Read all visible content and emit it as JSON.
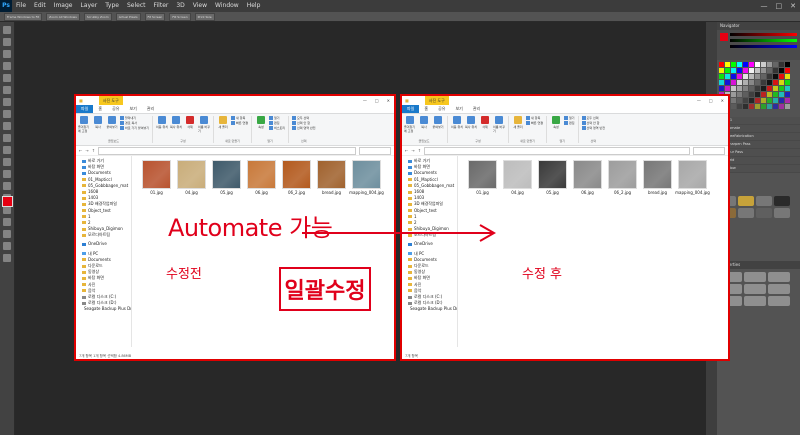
{
  "photoshop": {
    "logo": "Ps",
    "menu": [
      "File",
      "Edit",
      "Image",
      "Layer",
      "Type",
      "Select",
      "Filter",
      "3D",
      "View",
      "Window",
      "Help"
    ],
    "window_controls": [
      "—",
      "□",
      "✕"
    ],
    "options_bar": [
      "Frame Windows to Fit",
      "Zoom All Windows",
      "Scrubby Zoom",
      "Actual Pixels",
      "Fit Screen",
      "Fill Screen",
      "Print Size"
    ],
    "panels": {
      "navigator": "Navigator",
      "actions": [
        "Set 1",
        "Automate",
        "FreeFabrication",
        "Sharpen Pass",
        "Blur Pass",
        "Grid",
        "Glow"
      ],
      "properties": "Properties"
    }
  },
  "before_window": {
    "title_tab": "사진 도구",
    "tabs": [
      "파일",
      "홈",
      "공유",
      "보기",
      "관리"
    ],
    "ribbon": {
      "clipboard": {
        "label": "클립보드",
        "buttons": [
          "즐겨찾기에 고정",
          "복사",
          "붙여넣기"
        ],
        "small": [
          "잘라내기",
          "경로 복사",
          "바로 가기 붙여넣기"
        ]
      },
      "organize": {
        "label": "구성",
        "buttons": [
          "이동 위치",
          "복사 위치",
          "삭제",
          "이름 바꾸기"
        ]
      },
      "new": {
        "label": "새로 만들기",
        "buttons": [
          "새 폴더"
        ],
        "small": [
          "새 항목",
          "빠른 연결"
        ]
      },
      "open": {
        "label": "열기",
        "buttons": [
          "속성"
        ],
        "small": [
          "열기",
          "편집",
          "히스토리"
        ]
      },
      "select": {
        "label": "선택",
        "small": [
          "모두 선택",
          "선택 안 함",
          "선택 영역 반전"
        ]
      }
    },
    "nav": [
      "바로 가기",
      "바탕 화면",
      "Documents",
      "01_Mapticcl",
      "05_Gobbbagen_mat",
      "1608",
      "1403",
      "3D 배경작업파일",
      "Object_test",
      "1",
      "2",
      "Shibuya_Digimon",
      "모르다아트팀",
      "OneDrive",
      "내 PC",
      "Documents",
      "다운로드",
      "동영상",
      "바탕 화면",
      "사진",
      "음악",
      "로컬 디스크 (C:)",
      "로컬 디스크 (D:)",
      "Seagate Backup Plus Dr"
    ],
    "files": [
      {
        "name": "01.jpg",
        "color": "#b8532f"
      },
      {
        "name": "04.jpg",
        "color": "#c9ad7a"
      },
      {
        "name": "05.jpg",
        "color": "#3f5a6a"
      },
      {
        "name": "06.jpg",
        "color": "#c8793a"
      },
      {
        "name": "06_2.jpg",
        "color": "#b35a1e"
      },
      {
        "name": "bread.jpg",
        "color": "#a0622e"
      },
      {
        "name": "mapping_004.jpg",
        "color": "#6e8f9e"
      }
    ],
    "status": "7개 항목   1개 항목 선택함 4.86MB"
  },
  "after_window": {
    "title_tab": "사진 도구",
    "tabs": [
      "파일",
      "홈",
      "공유",
      "보기",
      "관리"
    ],
    "nav": [
      "바로 가기",
      "바탕 화면",
      "Documents",
      "01_Mapticcl",
      "05_Gobbbagen_mat",
      "1608",
      "1403",
      "3D 배경작업파일",
      "Object_test",
      "1",
      "2",
      "Shibuya_Digimon",
      "모르다아트팀",
      "OneDrive",
      "내 PC",
      "Documents",
      "다운로드",
      "동영상",
      "바탕 화면",
      "사진",
      "음악",
      "로컬 디스크 (C:)",
      "로컬 디스크 (D:)",
      "Seagate Backup Plus Dr"
    ],
    "files": [
      {
        "name": "01.jpg",
        "color": "#6a6a6a"
      },
      {
        "name": "04.jpg",
        "color": "#bdbdbd"
      },
      {
        "name": "05.jpg",
        "color": "#3a3a3a"
      },
      {
        "name": "06.jpg",
        "color": "#8a8a8a"
      },
      {
        "name": "06_2.jpg",
        "color": "#9d9d9d"
      },
      {
        "name": "bread.jpg",
        "color": "#777777"
      },
      {
        "name": "mapping_004.jpg",
        "color": "#a8a8a8"
      }
    ],
    "status": "7개 항목"
  },
  "annotations": {
    "automate": "Automate 가능",
    "before": "수정전",
    "after": "수정 후",
    "batch": "일괄수정"
  },
  "colors": {
    "accent_red": "#e0001b",
    "ps_bg": "#282828",
    "file_tab": "#1979ca"
  }
}
